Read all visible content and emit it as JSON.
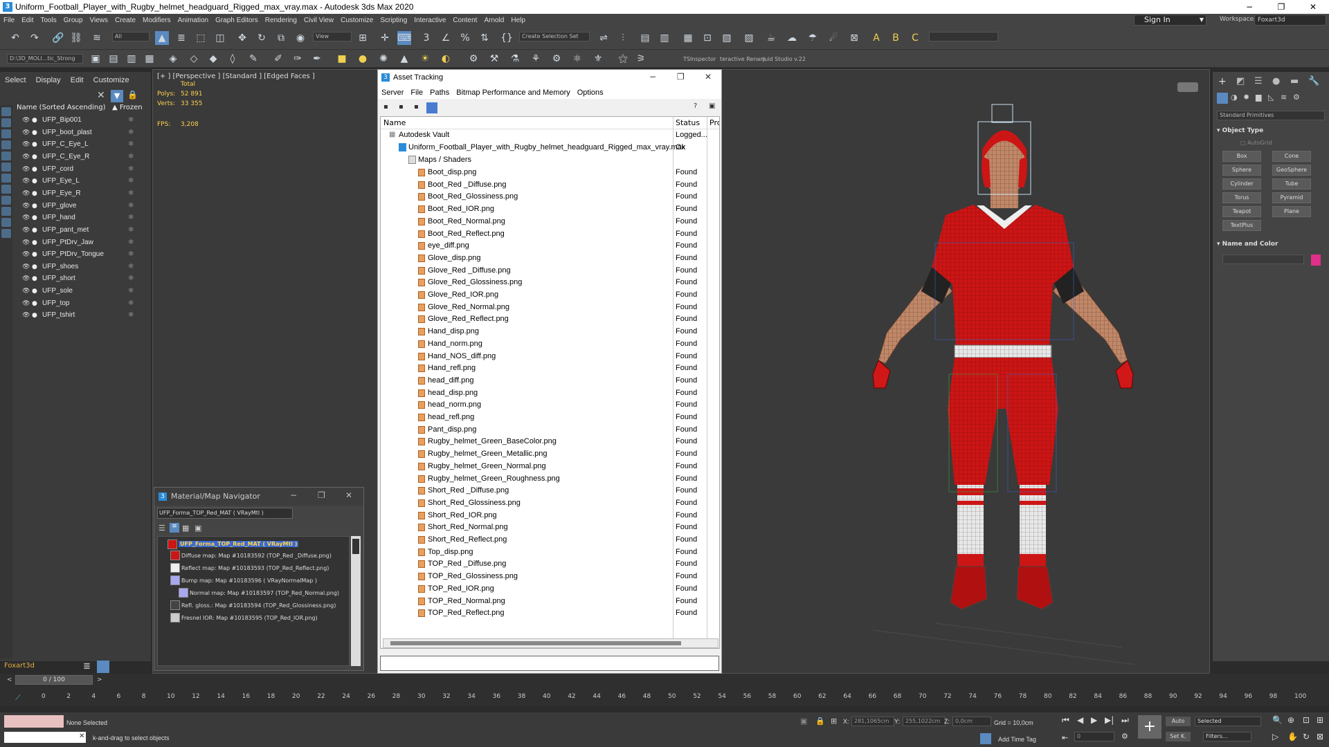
{
  "window": {
    "title": "Uniform_Football_Player_with_Rugby_helmet_headguard_Rigged_max_vray.max - Autodesk 3ds Max 2020",
    "minimize": "−",
    "maximize": "❐",
    "close": "✕"
  },
  "menu": [
    "File",
    "Edit",
    "Tools",
    "Group",
    "Views",
    "Create",
    "Modifiers",
    "Animation",
    "Graph Editors",
    "Rendering",
    "Civil View",
    "Customize",
    "Scripting",
    "Interactive",
    "Content",
    "Arnold",
    "Help"
  ],
  "signin": "Sign In",
  "workspace": {
    "label": "Workspaces:",
    "value": "Foxart3d"
  },
  "toolbar": {
    "filter_all": "All",
    "view_dropdown": "View",
    "selection_set": "Create Selection Set",
    "path": "D:\\3D_MOLI...tic_Strong",
    "tsinspector": "TSInspector",
    "interactive": "teractive Renam",
    "studio": "juid Studio v.22"
  },
  "scene_explorer": {
    "tabs": [
      "Select",
      "Display",
      "Edit",
      "Customize"
    ],
    "col_name": "Name (Sorted Ascending)",
    "col_frozen": "▲ Frozen",
    "items": [
      "UFP_Bip001",
      "UFP_boot_plast",
      "UFP_C_Eye_L",
      "UFP_C_Eye_R",
      "UFP_cord",
      "UFP_Eye_L",
      "UFP_Eye_R",
      "UFP_glove",
      "UFP_hand",
      "UFP_pant_met",
      "UFP_PtDrv_Jaw",
      "UFP_PtDrv_Tongue",
      "UFP_shoes",
      "UFP_short",
      "UFP_sole",
      "UFP_top",
      "UFP_tshirt"
    ],
    "bottom_label": "Foxart3d"
  },
  "viewport": {
    "label": "[+ ] [Perspective ] [Standard ] [Edged Faces ]",
    "total": "Total",
    "polys_label": "Polys:",
    "polys": "52 891",
    "verts_label": "Verts:",
    "verts": "33 355",
    "fps_label": "FPS:",
    "fps": "3,208"
  },
  "material_navigator": {
    "title": "Material/Map Navigator",
    "field": "UFP_Forma_TOP_Red_MAT  ( VRayMtl )",
    "root": "UFP_Forma_TOP_Red_MAT  ( VRayMtl )",
    "maps": [
      "Diffuse map: Map #10183592 (TOP_Red _Diffuse.png)",
      "Reflect map: Map #10183593 (TOP_Red_Reflect.png)",
      "Bump map: Map #10183596  ( VRayNormalMap )",
      "Normal map: Map #10183597 (TOP_Red_Normal.png)",
      "Refl. gloss.: Map #10183594 (TOP_Red_Glossiness.png)",
      "Fresnel IOR: Map #10183595 (TOP_Red_IOR.png)"
    ]
  },
  "asset_tracking": {
    "title": "Asset Tracking",
    "menu": [
      "Server",
      "File",
      "Paths",
      "Bitmap Performance and Memory",
      "Options"
    ],
    "col_name": "Name",
    "col_status": "Status",
    "col_proxy": "Pro:",
    "vault": {
      "name": "Autodesk Vault",
      "status": "Logged..."
    },
    "file": {
      "name": "Uniform_Football_Player_with_Rugby_helmet_headguard_Rigged_max_vray.max",
      "status": "Ok"
    },
    "folder": "Maps / Shaders",
    "maps": [
      {
        "name": "Boot_disp.png",
        "status": "Found"
      },
      {
        "name": "Boot_Red _Diffuse.png",
        "status": "Found"
      },
      {
        "name": "Boot_Red_Glossiness.png",
        "status": "Found"
      },
      {
        "name": "Boot_Red_IOR.png",
        "status": "Found"
      },
      {
        "name": "Boot_Red_Normal.png",
        "status": "Found"
      },
      {
        "name": "Boot_Red_Reflect.png",
        "status": "Found"
      },
      {
        "name": "eye_diff.png",
        "status": "Found"
      },
      {
        "name": "Glove_disp.png",
        "status": "Found"
      },
      {
        "name": "Glove_Red _Diffuse.png",
        "status": "Found"
      },
      {
        "name": "Glove_Red_Glossiness.png",
        "status": "Found"
      },
      {
        "name": "Glove_Red_IOR.png",
        "status": "Found"
      },
      {
        "name": "Glove_Red_Normal.png",
        "status": "Found"
      },
      {
        "name": "Glove_Red_Reflect.png",
        "status": "Found"
      },
      {
        "name": "Hand_disp.png",
        "status": "Found"
      },
      {
        "name": "Hand_norm.png",
        "status": "Found"
      },
      {
        "name": "Hand_NOS_diff.png",
        "status": "Found"
      },
      {
        "name": "Hand_refl.png",
        "status": "Found"
      },
      {
        "name": "head_diff.png",
        "status": "Found"
      },
      {
        "name": "head_disp.png",
        "status": "Found"
      },
      {
        "name": "head_norm.png",
        "status": "Found"
      },
      {
        "name": "head_refl.png",
        "status": "Found"
      },
      {
        "name": "Pant_disp.png",
        "status": "Found"
      },
      {
        "name": "Rugby_helmet_Green_BaseColor.png",
        "status": "Found"
      },
      {
        "name": "Rugby_helmet_Green_Metallic.png",
        "status": "Found"
      },
      {
        "name": "Rugby_helmet_Green_Normal.png",
        "status": "Found"
      },
      {
        "name": "Rugby_helmet_Green_Roughness.png",
        "status": "Found"
      },
      {
        "name": "Short_Red _Diffuse.png",
        "status": "Found"
      },
      {
        "name": "Short_Red_Glossiness.png",
        "status": "Found"
      },
      {
        "name": "Short_Red_IOR.png",
        "status": "Found"
      },
      {
        "name": "Short_Red_Normal.png",
        "status": "Found"
      },
      {
        "name": "Short_Red_Reflect.png",
        "status": "Found"
      },
      {
        "name": "Top_disp.png",
        "status": "Found"
      },
      {
        "name": "TOP_Red _Diffuse.png",
        "status": "Found"
      },
      {
        "name": "TOP_Red_Glossiness.png",
        "status": "Found"
      },
      {
        "name": "TOP_Red_IOR.png",
        "status": "Found"
      },
      {
        "name": "TOP_Red_Normal.png",
        "status": "Found"
      },
      {
        "name": "TOP_Red_Reflect.png",
        "status": "Found"
      }
    ]
  },
  "command_panel": {
    "category": "Standard Primitives",
    "object_type": "Object Type",
    "autogrid": "AutoGrid",
    "primitives": [
      "Box",
      "Cone",
      "Sphere",
      "GeoSphere",
      "Cylinder",
      "Tube",
      "Torus",
      "Pyramid",
      "Teapot",
      "Plane",
      "TextPlus"
    ],
    "name_and_color": "Name and Color",
    "color": "#e0308a"
  },
  "timeline": {
    "frame": "0 / 100",
    "ticks": [
      "0",
      "2",
      "4",
      "6",
      "8",
      "10",
      "12",
      "14",
      "16",
      "18",
      "20",
      "22",
      "24",
      "26",
      "28",
      "30",
      "32",
      "34",
      "36",
      "38",
      "40",
      "42",
      "44",
      "46",
      "48",
      "50",
      "52",
      "54",
      "56",
      "58",
      "60",
      "62",
      "64",
      "66",
      "68",
      "70",
      "72",
      "74",
      "76",
      "78",
      "80",
      "82",
      "84",
      "86",
      "88",
      "90",
      "92",
      "94",
      "96",
      "98",
      "100"
    ]
  },
  "status": {
    "none_selected": "None Selected",
    "hint": "k-and-drag to select objects",
    "x_label": "X:",
    "x_val": "281,1065cm",
    "y_label": "Y:",
    "y_val": "255,1022cm",
    "z_label": "Z:",
    "z_val": "0,0cm",
    "grid": "Grid = 10,0cm",
    "add_time_tag": "Add Time Tag",
    "auto": "Auto",
    "selected": "Selected",
    "setk": "Set K.",
    "filters": "Filters...",
    "frame_field": "0"
  }
}
